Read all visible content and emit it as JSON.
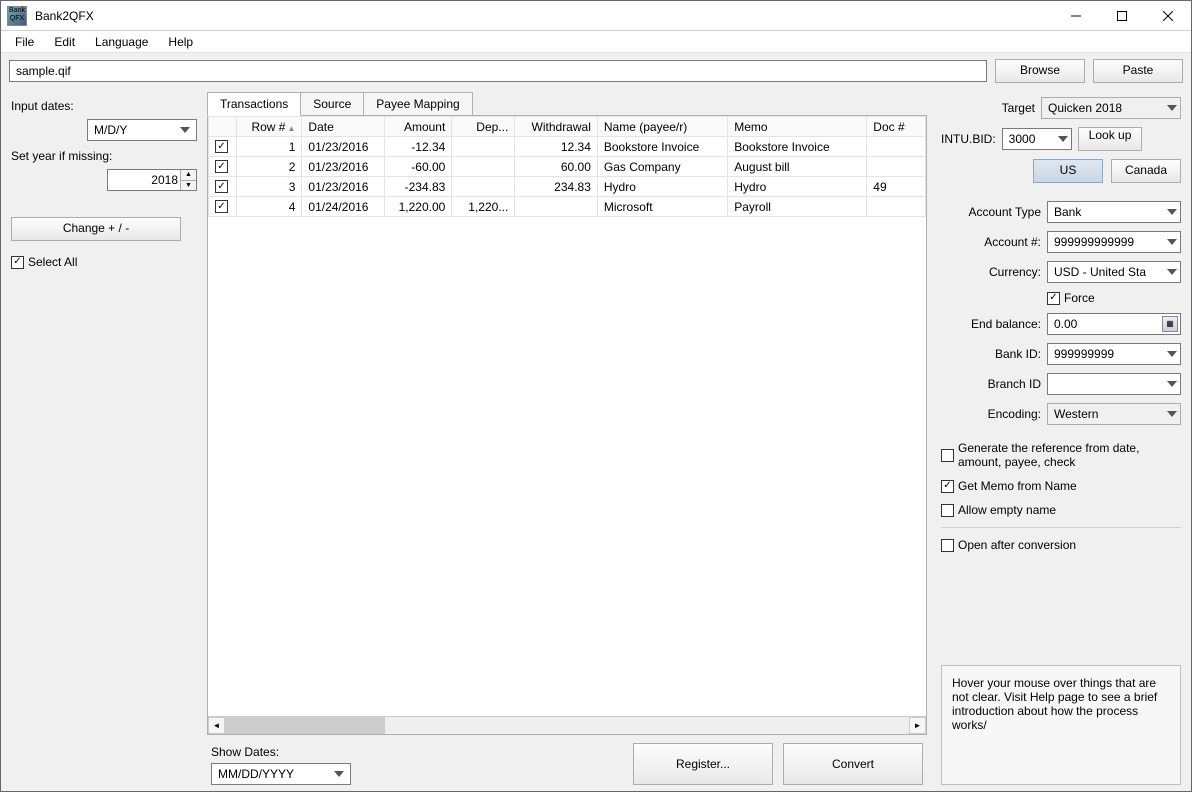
{
  "title": "Bank2QFX",
  "menus": {
    "file": "File",
    "edit": "Edit",
    "language": "Language",
    "help": "Help"
  },
  "path_value": "sample.qif",
  "browse_label": "Browse",
  "paste_label": "Paste",
  "left": {
    "input_dates_label": "Input dates:",
    "input_dates_value": "M/D/Y",
    "set_year_label": "Set year if missing:",
    "set_year_value": "2018",
    "change_sign_label": "Change + / -",
    "select_all_label": "Select All",
    "select_all_checked": true
  },
  "tabs": {
    "transactions": "Transactions",
    "source": "Source",
    "payee": "Payee Mapping"
  },
  "columns": {
    "row": "Row #",
    "date": "Date",
    "amount": "Amount",
    "deposit": "Dep...",
    "withdrawal": "Withdrawal",
    "name": "Name (payee/r)",
    "memo": "Memo",
    "doc": "Doc #"
  },
  "rows": [
    {
      "n": "1",
      "date": "01/23/2016",
      "amount": "-12.34",
      "deposit": "",
      "withdrawal": "12.34",
      "name": "Bookstore Invoice",
      "memo": "Bookstore Invoice",
      "doc": ""
    },
    {
      "n": "2",
      "date": "01/23/2016",
      "amount": "-60.00",
      "deposit": "",
      "withdrawal": "60.00",
      "name": "Gas Company",
      "memo": "August bill",
      "doc": ""
    },
    {
      "n": "3",
      "date": "01/23/2016",
      "amount": "-234.83",
      "deposit": "",
      "withdrawal": "234.83",
      "name": "Hydro",
      "memo": "Hydro",
      "doc": "49"
    },
    {
      "n": "4",
      "date": "01/24/2016",
      "amount": "1,220.00",
      "deposit": "1,220...",
      "withdrawal": "",
      "name": "Microsoft",
      "memo": "Payroll",
      "doc": ""
    }
  ],
  "bottom": {
    "show_dates_label": "Show Dates:",
    "show_dates_value": "MM/DD/YYYY",
    "register_label": "Register...",
    "convert_label": "Convert"
  },
  "right": {
    "target_label": "Target",
    "target_value": "Quicken 2018",
    "intu_label": "INTU.BID:",
    "intu_value": "3000",
    "lookup_label": "Look up",
    "us_label": "US",
    "canada_label": "Canada",
    "account_type_label": "Account Type",
    "account_type_value": "Bank",
    "account_num_label": "Account #:",
    "account_num_value": "999999999999",
    "currency_label": "Currency:",
    "currency_value": "USD - United Sta",
    "force_label": "Force",
    "force_checked": true,
    "end_balance_label": "End balance:",
    "end_balance_value": "0.00",
    "bank_id_label": "Bank ID:",
    "bank_id_value": "999999999",
    "branch_id_label": "Branch ID",
    "branch_id_value": "",
    "encoding_label": "Encoding:",
    "encoding_value": "Western",
    "gen_ref_label": "Generate the reference from date, amount, payee, check",
    "gen_ref_checked": false,
    "get_memo_label": "Get Memo from Name",
    "get_memo_checked": true,
    "allow_empty_label": "Allow empty name",
    "allow_empty_checked": false,
    "open_after_label": "Open after conversion",
    "open_after_checked": false,
    "help_text": "Hover your mouse over things that are not clear. Visit Help page to see a brief introduction about how the process works/"
  }
}
